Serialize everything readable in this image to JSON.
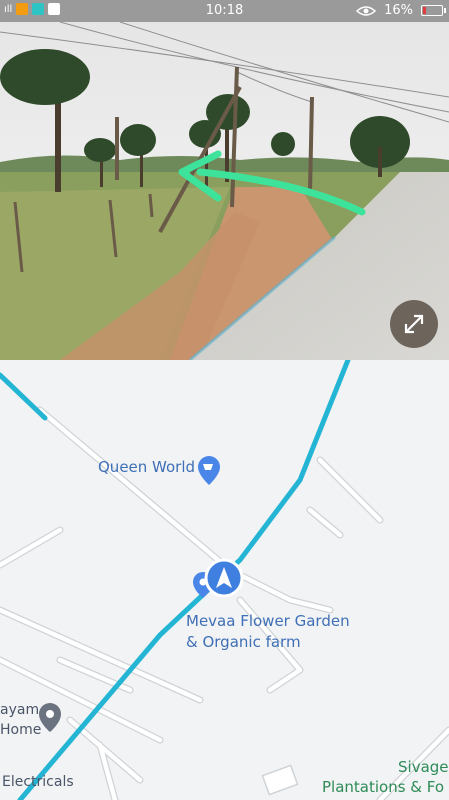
{
  "status_bar": {
    "time": "10:18",
    "battery_text": "16%",
    "battery_level": 0.16,
    "battery_color": "#e43c3c",
    "app_icons": [
      "signal-icon",
      "wifi-icon",
      "notification-icon",
      "youtube-icon"
    ]
  },
  "street_view": {
    "arrow_color": "#3de39b",
    "expand_icon": "expand-icon"
  },
  "map": {
    "route_color": "#23b5d3",
    "places": {
      "queen_world": "Queen World",
      "mevaa_line1": "Mevaa Flower Garden",
      "mevaa_line2": "& Organic farm",
      "ayam_line1": "ayam",
      "ayam_line2": "Home",
      "electricals": "Electricals",
      "sivageeth_line1": "Sivagee",
      "sivageeth_line2": "Plantations & Fo"
    }
  }
}
